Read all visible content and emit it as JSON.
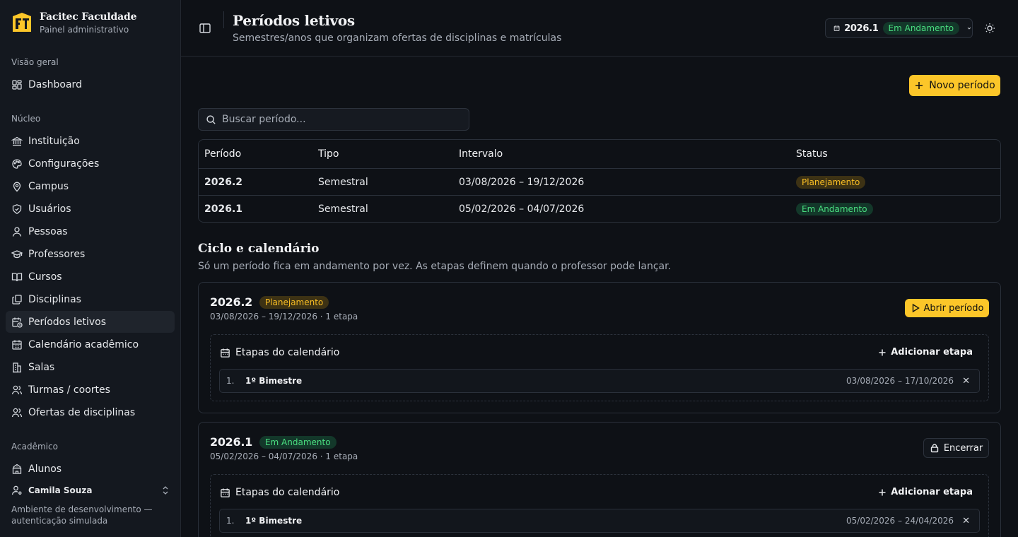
{
  "brand": {
    "name": "Facitec Faculdade",
    "subtitle": "Painel administrativo"
  },
  "sidebar": {
    "sections": [
      {
        "label": "Visão geral"
      },
      {
        "label": "Núcleo"
      },
      {
        "label": "Acadêmico"
      }
    ],
    "items": [
      {
        "label": "Dashboard",
        "icon": "dashboard-icon"
      },
      {
        "label": "Instituição",
        "icon": "landmark-icon"
      },
      {
        "label": "Configurações",
        "icon": "palette-icon"
      },
      {
        "label": "Campus",
        "icon": "map-pin-icon"
      },
      {
        "label": "Usuários",
        "icon": "shield-icon"
      },
      {
        "label": "Pessoas",
        "icon": "user-icon"
      },
      {
        "label": "Professores",
        "icon": "graduation-cap-icon"
      },
      {
        "label": "Cursos",
        "icon": "book-open-icon"
      },
      {
        "label": "Disciplinas",
        "icon": "library-icon"
      },
      {
        "label": "Períodos letivos",
        "icon": "calendar-clock-icon",
        "active": true
      },
      {
        "label": "Calendário acadêmico",
        "icon": "calendar-icon"
      },
      {
        "label": "Salas",
        "icon": "building-icon"
      },
      {
        "label": "Turmas / coortes",
        "icon": "users-icon"
      },
      {
        "label": "Ofertas de disciplinas",
        "icon": "users-icon"
      },
      {
        "label": "Alunos",
        "icon": "school-icon"
      }
    ],
    "user": {
      "name": "Camila Souza"
    },
    "env_note": "Ambiente de desenvolvimento — autenticação simulada"
  },
  "header": {
    "title": "Períodos letivos",
    "subtitle": "Semestres/anos que organizam ofertas de disciplinas e matrículas",
    "current_period": "2026.1",
    "current_status": "Em Andamento"
  },
  "main": {
    "new_button": "Novo período",
    "search_placeholder": "Buscar período...",
    "table": {
      "columns": [
        "Período",
        "Tipo",
        "Intervalo",
        "Status"
      ],
      "rows": [
        {
          "periodo": "2026.2",
          "tipo": "Semestral",
          "intervalo": "03/08/2026 – 19/12/2026",
          "status": "Planejamento"
        },
        {
          "periodo": "2026.1",
          "tipo": "Semestral",
          "intervalo": "05/02/2026 – 04/07/2026",
          "status": "Em Andamento"
        }
      ]
    },
    "cycle": {
      "title": "Ciclo e calendário",
      "subtitle": "Só um período fica em andamento por vez. As etapas definem quando o professor pode lançar."
    },
    "cards": [
      {
        "name": "2026.2",
        "status": "Planejamento",
        "meta": "03/08/2026 – 19/12/2026 · 1 etapa",
        "action": "Abrir período",
        "stages_title": "Etapas do calendário",
        "add_stage": "Adicionar etapa",
        "stages": [
          {
            "num": "1.",
            "name": "1º Bimestre",
            "range": "03/08/2026 – 17/10/2026"
          }
        ]
      },
      {
        "name": "2026.1",
        "status": "Em Andamento",
        "meta": "05/02/2026 – 04/07/2026 · 1 etapa",
        "action": "Encerrar",
        "stages_title": "Etapas do calendário",
        "add_stage": "Adicionar etapa",
        "stages": [
          {
            "num": "1.",
            "name": "1º Bimestre",
            "range": "05/02/2026 – 24/04/2026"
          }
        ]
      }
    ]
  },
  "colors": {
    "accent": "#fcc629",
    "background": "#0e1116",
    "sidebar": "#14181f",
    "success": "#4ade80",
    "warning": "#fbbf24"
  }
}
